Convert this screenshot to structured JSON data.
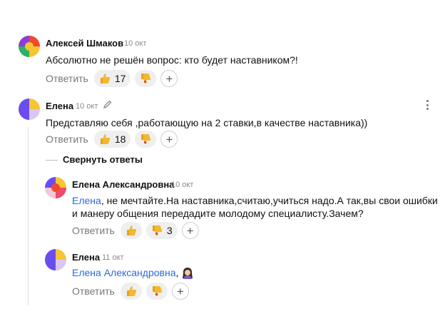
{
  "comments": [
    {
      "author": "Алексей Шмаков",
      "date": "10 окт",
      "text": "Абсолютно не решён вопрос: кто будет наставником?!",
      "reply_label": "Ответить",
      "likes": "17",
      "dislikes": "",
      "add_reaction": "+"
    },
    {
      "author": "Елена",
      "date": "10 окт",
      "text": "Представляю себя ,работающую на 2 ставки,в качестве наставника))",
      "reply_label": "Ответить",
      "likes": "18",
      "dislikes": "",
      "add_reaction": "+",
      "edited_icon": "pencil-icon"
    }
  ],
  "collapse_label": "Свернуть ответы",
  "replies": [
    {
      "author": "Елена Александровна",
      "date": "10 окт",
      "mention": "Елена",
      "text_line1": ", не мечтайте.На наставника,считаю,учиться надо.А так,вы свои ошибки",
      "text_line2": "и манеру общения передадите молодому специалисту.Зачем?",
      "reply_label": "Ответить",
      "likes": "",
      "dislikes": "3",
      "add_reaction": "+"
    },
    {
      "author": "Елена",
      "date": "11 окт",
      "mention": "Елена Александровна",
      "text_after": ",",
      "emoji": "woman-emoji",
      "reply_label": "Ответить",
      "likes": "",
      "dislikes": "",
      "add_reaction": "+"
    }
  ],
  "icons": {
    "like": "thumbs-up-icon",
    "dislike": "thumbs-down-icon",
    "add": "plus-icon",
    "menu": "kebab-menu-icon"
  },
  "colors": {
    "mention": "#2a6ad8",
    "secondary": "#777777",
    "reaction_bg": "#efefef",
    "date": "#8a8a8a"
  }
}
